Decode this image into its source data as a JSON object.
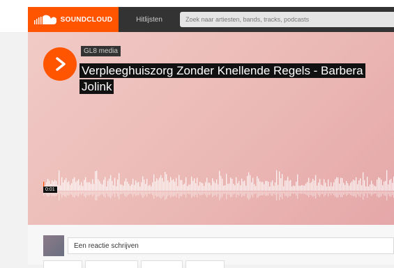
{
  "header": {
    "brand": "SOUNDCLOUD",
    "nav_tab": "Hitlijsten",
    "search_placeholder": "Zoek naar artiesten, bands, tracks, podcasts",
    "brand_color": "#ff5500"
  },
  "track": {
    "artist": "GL8 media",
    "title": "Verpleeghuiszorg Zonder Knellende Regels - Barbera Jolink",
    "current_time": "0:01",
    "background_colors": [
      "#f1cac6",
      "#e5a7a9"
    ]
  },
  "comment": {
    "placeholder": "Een reactie schrijven"
  }
}
